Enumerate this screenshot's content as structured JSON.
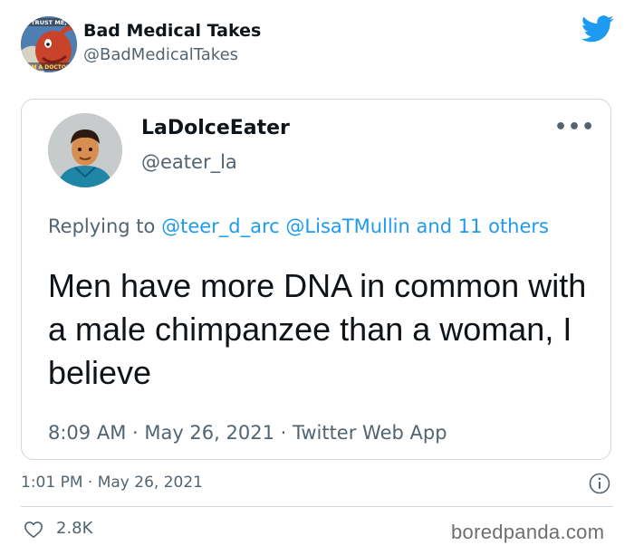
{
  "outer_tweet": {
    "avatar_text_top": "TRUST ME,",
    "avatar_text_bottom": "I'M A DOCTOR",
    "display_name": "Bad Medical Takes",
    "handle": "@BadMedicalTakes",
    "timestamp": "1:01 PM · May 26, 2021",
    "likes": "2.8K"
  },
  "quoted_tweet": {
    "display_name": "LaDolceEater",
    "handle": "@eater_la",
    "more_label": "•••",
    "replying_prefix": "Replying to",
    "replying_mention_1": "@teer_d_arc",
    "replying_mention_2": "@LisaTMullin",
    "replying_others": "and 11 others",
    "text": "Men have more DNA in common with a male chimpanzee than a woman, I believe",
    "timestamp": "8:09 AM · May 26, 2021 · Twitter Web App"
  },
  "watermark": "boredpanda.com",
  "colors": {
    "twitter_blue": "#1d9bf0",
    "secondary_text": "#536471",
    "border": "#cfd9de"
  },
  "icons": [
    "twitter-bird-icon",
    "more-icon",
    "info-icon",
    "heart-icon"
  ]
}
